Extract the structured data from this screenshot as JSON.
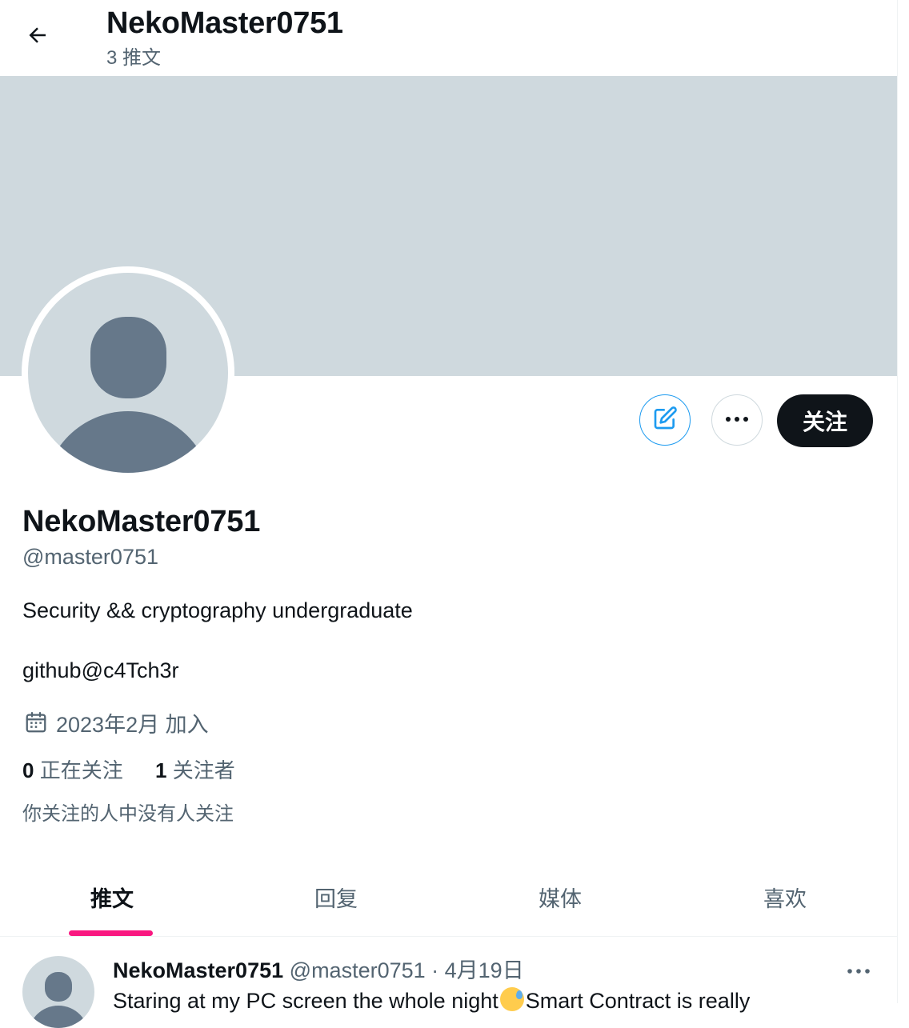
{
  "header": {
    "name": "NekoMaster0751",
    "post_count": "3 推文"
  },
  "profile": {
    "name": "NekoMaster0751",
    "handle": "@master0751",
    "bio_line1": "Security && cryptography undergraduate",
    "bio_line2": "github@c4Tch3r",
    "joined": "2023年2月 加入",
    "following_count": "0",
    "following_label": "正在关注",
    "followers_count": "1",
    "followers_label": "关注者",
    "mutual_note": "你关注的人中没有人关注"
  },
  "actions": {
    "follow_label": "关注"
  },
  "tabs": [
    {
      "label": "推文",
      "active": true
    },
    {
      "label": "回复",
      "active": false
    },
    {
      "label": "媒体",
      "active": false
    },
    {
      "label": "喜欢",
      "active": false
    }
  ],
  "tweet": {
    "name": "NekoMaster0751",
    "meta": "@master0751 · 4月19日",
    "text_before": "Staring at my PC screen the whole night",
    "text_after": "Smart Contract is really"
  },
  "icons": {
    "back": "arrow-left-icon",
    "edit": "edit-icon",
    "more": "more-icon",
    "calendar": "calendar-icon",
    "emoji": "sweat-emoji-icon"
  },
  "colors": {
    "accent": "#1d9bf0",
    "tab_indicator": "#f91880",
    "banner": "#cfd9de",
    "follow_button": "#0f1419",
    "secondary_text": "#536471"
  }
}
